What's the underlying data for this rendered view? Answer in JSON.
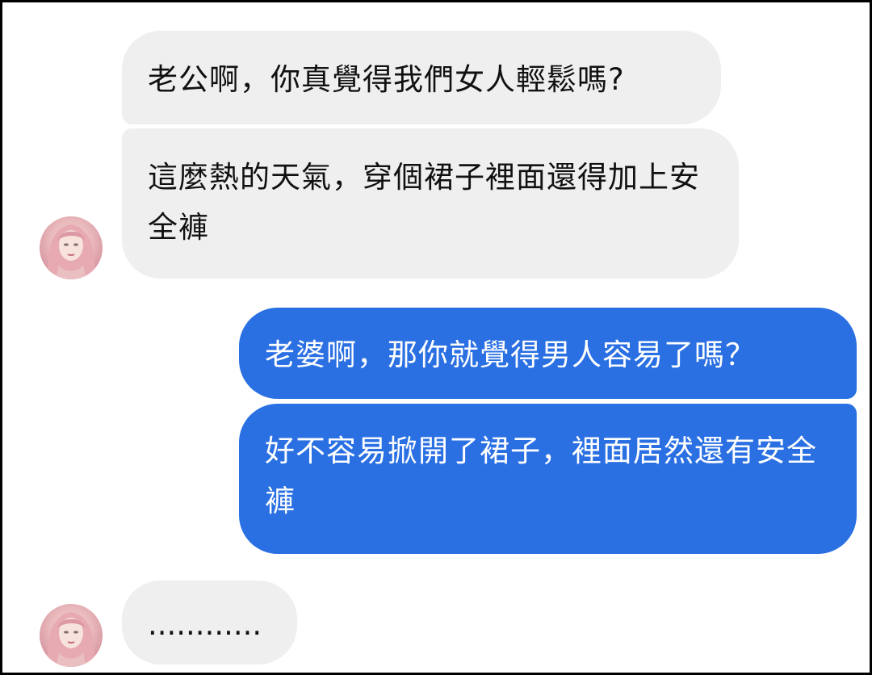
{
  "conversation": {
    "messages": [
      {
        "side": "received",
        "text": "老公啊，你真覺得我們女人輕鬆嗎?"
      },
      {
        "side": "received",
        "text": "這麼熱的天氣，穿個裙子裡面還得加上安全褲"
      },
      {
        "side": "sent",
        "text": "老婆啊，那你就覺得男人容易了嗎？"
      },
      {
        "side": "sent",
        "text": "好不容易掀開了裙子，裡面居然還有安全褲"
      },
      {
        "side": "received",
        "text": "............"
      }
    ]
  },
  "avatar": {
    "icon": "pink-hair-girl-avatar-icon"
  },
  "colors": {
    "received_bubble": "#efefef",
    "sent_bubble": "#2a70e3",
    "received_text": "#111111",
    "sent_text": "#ffffff"
  }
}
